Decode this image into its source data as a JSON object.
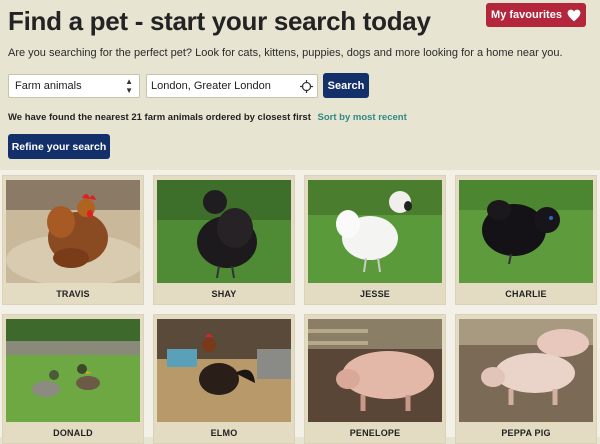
{
  "header": {
    "title": "Find a pet - start your search today",
    "favourites_label": "My favourites"
  },
  "intro_text": "Are you searching for the perfect pet? Look for cats, kittens, puppies, dogs and more looking for a home near you.",
  "search": {
    "category_selected": "Farm animals",
    "location_value": "London, Greater London",
    "search_label": "Search"
  },
  "results": {
    "summary": "We have found the nearest 21 farm animals ordered by closest first",
    "sort_link": "Sort by most recent",
    "refine_label": "Refine your search"
  },
  "colors": {
    "page_bg": "#e8e4d2",
    "primary_button": "#14306b",
    "favourites_button": "#b3263c",
    "link": "#2f8a86"
  },
  "pets": [
    {
      "name": "TRAVIS",
      "animal": "chicken"
    },
    {
      "name": "SHAY",
      "animal": "chicken"
    },
    {
      "name": "JESSE",
      "animal": "chicken"
    },
    {
      "name": "CHARLIE",
      "animal": "chicken"
    },
    {
      "name": "DONALD",
      "animal": "duck"
    },
    {
      "name": "ELMO",
      "animal": "chicken"
    },
    {
      "name": "PENELOPE",
      "animal": "pig"
    },
    {
      "name": "PEPPA PIG",
      "animal": "pig"
    }
  ]
}
